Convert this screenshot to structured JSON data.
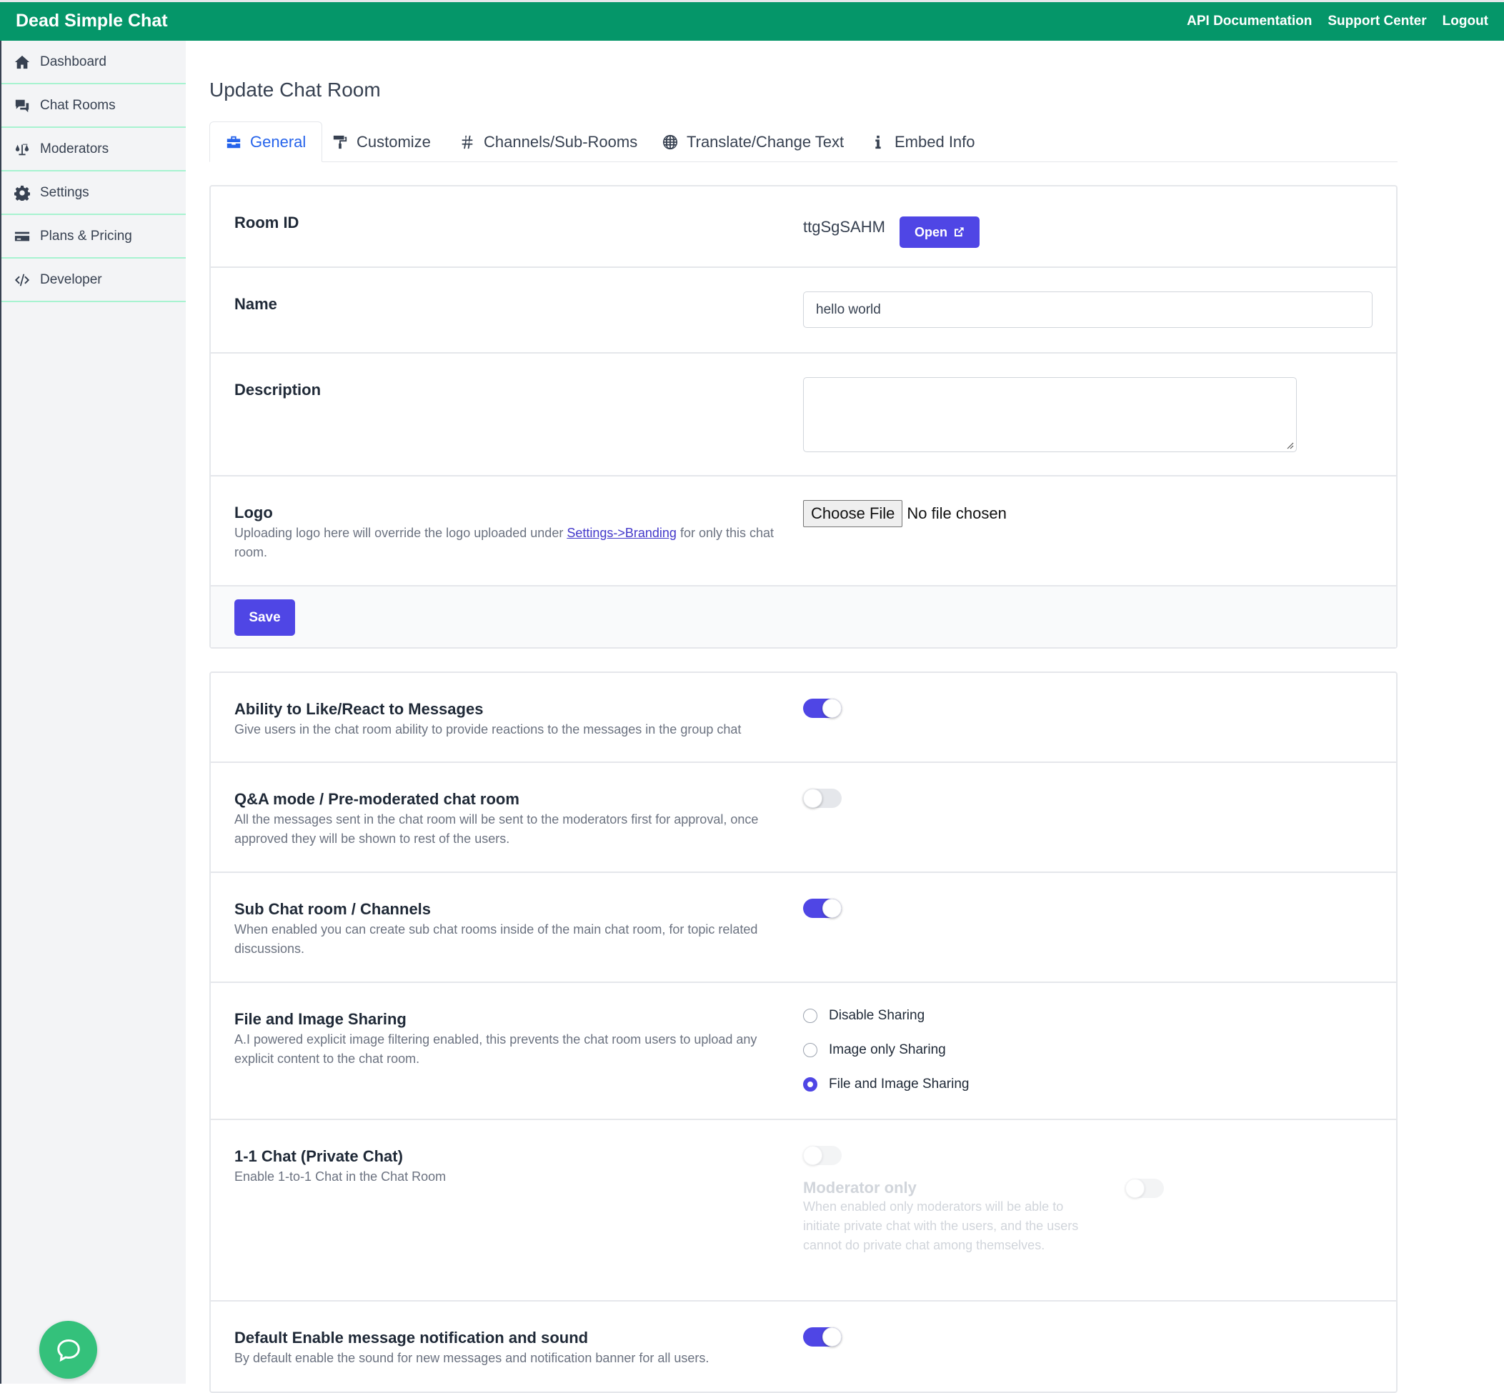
{
  "header": {
    "brand": "Dead Simple Chat",
    "links": [
      "API Documentation",
      "Support Center",
      "Logout"
    ]
  },
  "sidebar": {
    "items": [
      {
        "label": "Dashboard",
        "icon": "home-icon"
      },
      {
        "label": "Chat Rooms",
        "icon": "chat-icon"
      },
      {
        "label": "Moderators",
        "icon": "scale-icon"
      },
      {
        "label": "Settings",
        "icon": "gear-icon"
      },
      {
        "label": "Plans & Pricing",
        "icon": "credit-card-icon"
      },
      {
        "label": "Developer",
        "icon": "code-icon"
      }
    ]
  },
  "page": {
    "title": "Update Chat Room",
    "tabs": [
      {
        "label": "General",
        "icon": "toolbox-icon",
        "active": true
      },
      {
        "label": "Customize",
        "icon": "paint-roller-icon",
        "active": false
      },
      {
        "label": "Channels/Sub-Rooms",
        "icon": "hashtag-icon",
        "active": false
      },
      {
        "label": "Translate/Change Text",
        "icon": "globe-icon",
        "active": false
      },
      {
        "label": "Embed Info",
        "icon": "info-icon",
        "active": false
      }
    ]
  },
  "general": {
    "room_id_label": "Room ID",
    "room_id_value": "ttgSgSAHM",
    "open_label": "Open",
    "name_label": "Name",
    "name_value": "hello world",
    "description_label": "Description",
    "description_value": "",
    "logo_label": "Logo",
    "logo_desc_before": "Uploading logo here will override the logo uploaded under ",
    "logo_desc_link": "Settings->Branding",
    "logo_desc_after": " for only this chat room.",
    "choose_file_label": "Choose File",
    "no_file_text": "No file chosen",
    "save_label": "Save"
  },
  "features": {
    "reactions": {
      "title": "Ability to Like/React to Messages",
      "desc": "Give users in the chat room ability to provide reactions to the messages in the group chat",
      "enabled": true
    },
    "qa_mode": {
      "title": "Q&A mode / Pre-moderated chat room",
      "desc": "All the messages sent in the chat room will be sent to the moderators first for approval, once approved they will be shown to rest of the users.",
      "enabled": false
    },
    "channels": {
      "title": "Sub Chat room / Channels",
      "desc": "When enabled you can create sub chat rooms inside of the main chat room, for topic related discussions.",
      "enabled": true
    },
    "sharing": {
      "title": "File and Image Sharing",
      "desc": "A.I powered explicit image filtering enabled, this prevents the chat room users to upload any explicit content to the chat room.",
      "options": [
        "Disable Sharing",
        "Image only Sharing",
        "File and Image Sharing"
      ],
      "selected": "File and Image Sharing"
    },
    "private_chat": {
      "title": "1-1 Chat (Private Chat)",
      "desc": "Enable 1-to-1 Chat in the Chat Room",
      "enabled": false,
      "moderator_only_title": "Moderator only",
      "moderator_only_desc": "When enabled only moderators will be able to initiate private chat with the users, and the users cannot do private chat among themselves.",
      "moderator_only_enabled": false
    },
    "notifications": {
      "title": "Default Enable message notification and sound",
      "desc": "By default enable the sound for new messages and notification banner for all users.",
      "enabled": true
    }
  },
  "colors": {
    "brand_green": "#059669",
    "accent_indigo": "#4f46e5",
    "tab_active_blue": "#2563eb"
  }
}
